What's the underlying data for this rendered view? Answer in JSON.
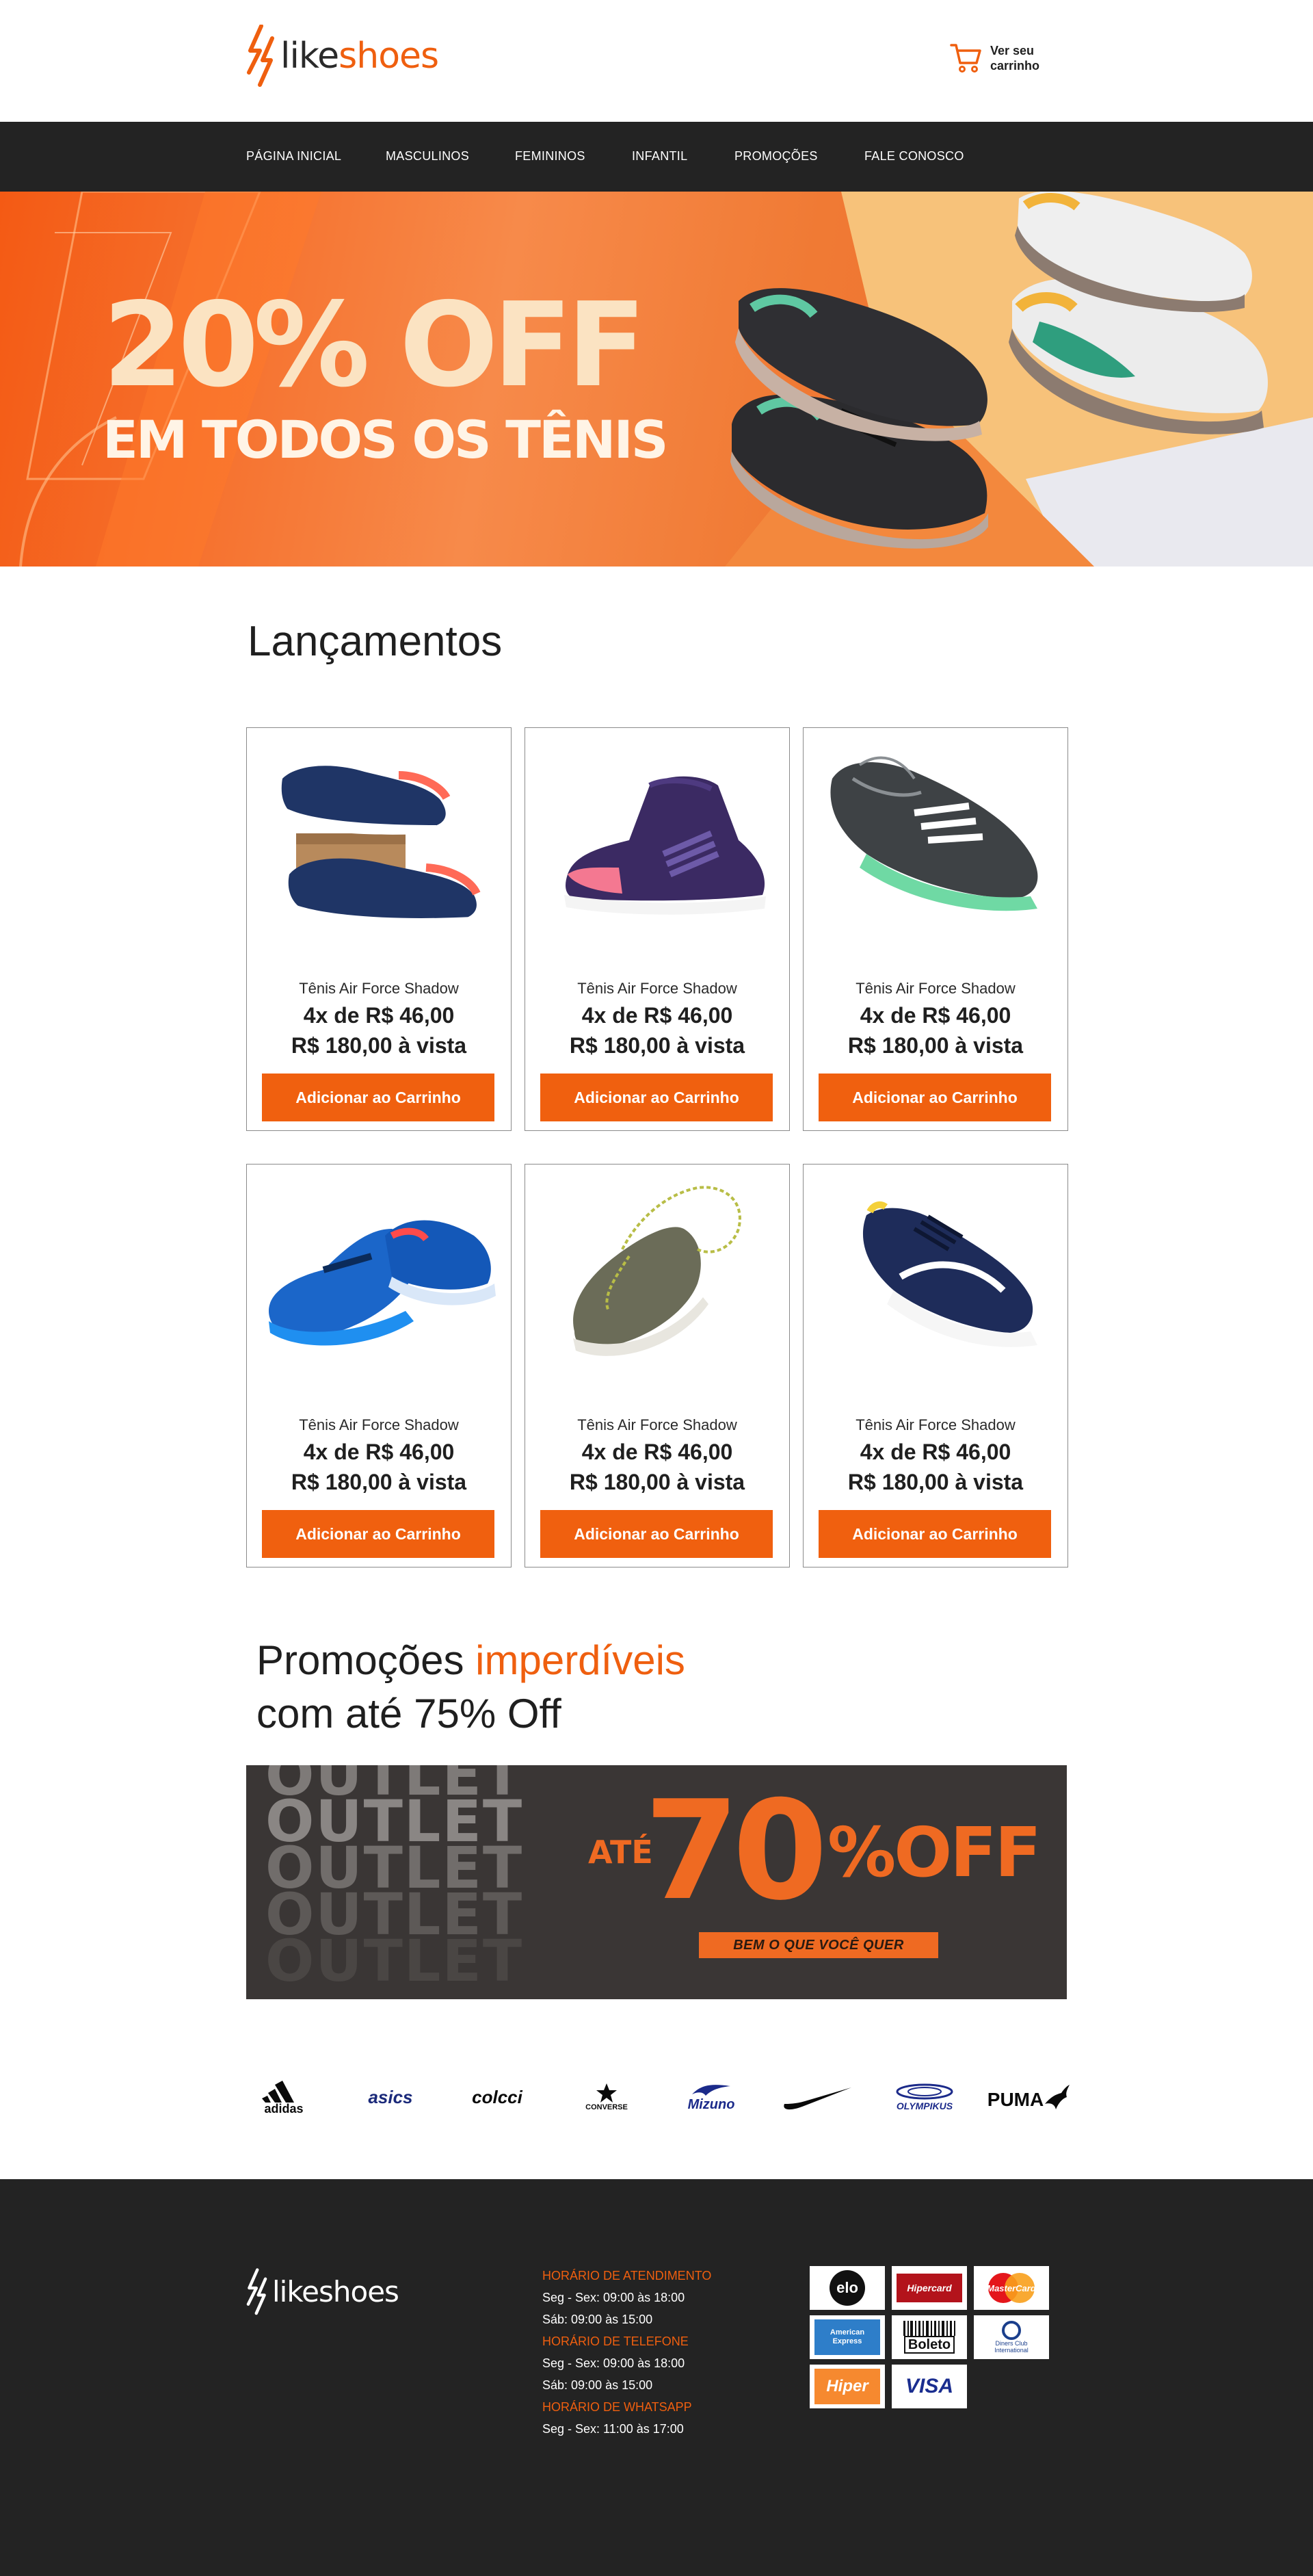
{
  "header": {
    "logo_like": "like",
    "logo_shoes": "shoes",
    "cart_label": "Ver seu carrinho"
  },
  "nav": {
    "items": [
      "PÁGINA INICIAL",
      "MASCULINOS",
      "FEMININOS",
      "INFANTIL",
      "PROMOÇÕES",
      "FALE CONOSCO"
    ]
  },
  "hero": {
    "line1": "20% OFF",
    "line2": "EM TODOS OS TÊNIS"
  },
  "launches": {
    "title": "Lançamentos",
    "products": [
      {
        "name": "Tênis Air Force Shadow",
        "installment": "4x de R$ 46,00",
        "cash": "R$ 180,00 à vista",
        "button": "Adicionar ao Carrinho",
        "image": "navy-coral-sneakers-on-box"
      },
      {
        "name": "Tênis Air Force Shadow",
        "installment": "4x de R$ 46,00",
        "cash": "R$ 180,00 à vista",
        "button": "Adicionar ao Carrinho",
        "image": "purple-pink-high-top"
      },
      {
        "name": "Tênis Air Force Shadow",
        "installment": "4x de R$ 46,00",
        "cash": "R$ 180,00 à vista",
        "button": "Adicionar ao Carrinho",
        "image": "grey-mint-running-shoe"
      },
      {
        "name": "Tênis Air Force Shadow",
        "installment": "4x de R$ 46,00",
        "cash": "R$ 180,00 à vista",
        "button": "Adicionar ao Carrinho",
        "image": "blue-air-sneakers"
      },
      {
        "name": "Tênis Air Force Shadow",
        "installment": "4x de R$ 46,00",
        "cash": "R$ 180,00 à vista",
        "button": "Adicionar ao Carrinho",
        "image": "olive-canvas-sneaker"
      },
      {
        "name": "Tênis Air Force Shadow",
        "installment": "4x de R$ 46,00",
        "cash": "R$ 180,00 à vista",
        "button": "Adicionar ao Carrinho",
        "image": "navy-white-runner"
      }
    ]
  },
  "promo": {
    "title_start": "Promoções ",
    "title_accent": "imperdíveis",
    "title_line2": "com até 75% Off"
  },
  "outlet": {
    "word": "OUTLET",
    "ate": "ATÉ",
    "number": "70",
    "off": "%OFF",
    "tagline": "BEM O QUE VOCÊ QUER"
  },
  "brands": [
    "adidas",
    "asics",
    "colcci",
    "CONVERSE",
    "Mizuno",
    "nike-swoosh",
    "OLYMPIKUS",
    "PUMA"
  ],
  "footer": {
    "logo_text": "likeshoes",
    "hours": [
      {
        "heading": "HORÁRIO DE ATENDIMENTO",
        "lines": [
          "Seg - Sex: 09:00 às 18:00",
          "Sáb: 09:00 às 15:00"
        ]
      },
      {
        "heading": "HORÁRIO DE TELEFONE",
        "lines": [
          "Seg - Sex: 09:00 às 18:00",
          "Sáb: 09:00 às 15:00"
        ]
      },
      {
        "heading": "HORÁRIO DE WHATSAPP",
        "lines": [
          "Seg - Sex: 11:00 às 17:00"
        ]
      }
    ],
    "payments": [
      "elo",
      "Hipercard",
      "MasterCard",
      "American Express",
      "Boleto",
      "Diners Club International",
      "Hiper",
      "VISA"
    ]
  },
  "colors": {
    "accent": "#ef5f0f",
    "dark": "#232323"
  }
}
